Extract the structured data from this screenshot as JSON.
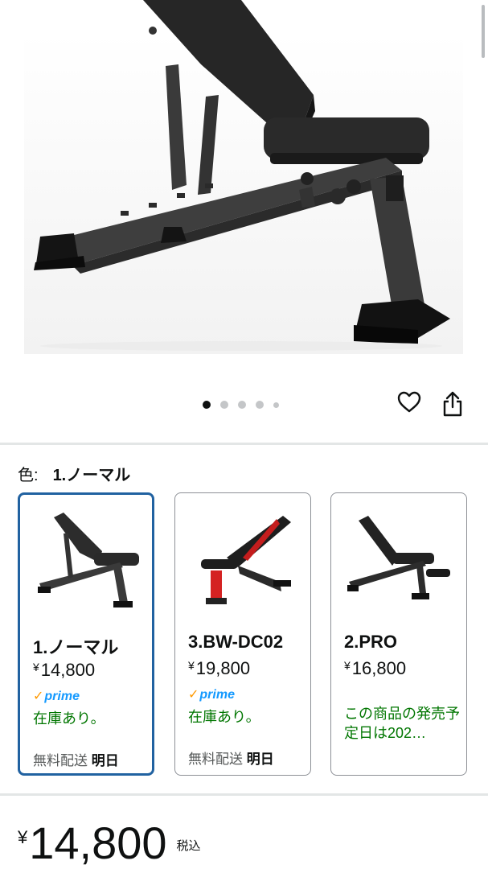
{
  "hero": {
    "carousel": {
      "total": 5,
      "active": 1
    },
    "wishlist_icon": "heart-icon",
    "share_icon": "share-icon"
  },
  "variation": {
    "label": "色:",
    "selected_value": "1.ノーマル",
    "options": [
      {
        "name": "1.ノーマル",
        "price_symbol": "¥",
        "price": "14,800",
        "prime": "prime",
        "availability": "在庫あり。",
        "delivery_label": "無料配送",
        "delivery_day": "明日",
        "selected": true
      },
      {
        "name": "3.BW-DC02",
        "price_symbol": "¥",
        "price": "19,800",
        "prime": "prime",
        "availability": "在庫あり。",
        "delivery_label": "無料配送",
        "delivery_day": "明日",
        "selected": false
      },
      {
        "name": "2.PRO",
        "price_symbol": "¥",
        "price": "16,800",
        "availability": "この商品の発売予定日は202…",
        "selected": false
      }
    ]
  },
  "price": {
    "symbol": "¥",
    "amount": "14,800",
    "tax_note": "税込"
  },
  "colors": {
    "selected_border": "#2162a1",
    "in_stock": "#007600",
    "prime_blue": "#1399ff",
    "prime_check": "#ff9900"
  }
}
